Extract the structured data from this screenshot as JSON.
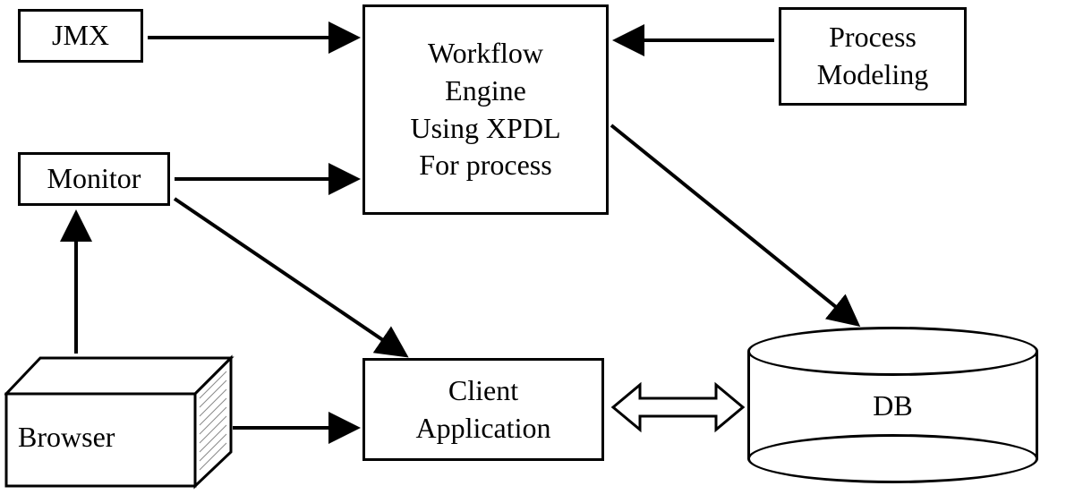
{
  "nodes": {
    "jmx": "JMX",
    "monitor": "Monitor",
    "browser": "Browser",
    "workflow_l1": "Workflow",
    "workflow_l2": "Engine",
    "workflow_l3": "Using XPDL",
    "workflow_l4": "For process",
    "process_l1": "Process",
    "process_l2": "Modeling",
    "client_l1": "Client",
    "client_l2": "Application",
    "db": "DB"
  },
  "diagram": {
    "type": "architecture",
    "edges": [
      {
        "from": "JMX",
        "to": "Workflow Engine",
        "direction": "uni"
      },
      {
        "from": "Process Modeling",
        "to": "Workflow Engine",
        "direction": "uni"
      },
      {
        "from": "Monitor",
        "to": "Workflow Engine",
        "direction": "uni"
      },
      {
        "from": "Monitor",
        "to": "Client Application",
        "direction": "uni"
      },
      {
        "from": "Browser",
        "to": "Monitor",
        "direction": "uni"
      },
      {
        "from": "Browser",
        "to": "Client Application",
        "direction": "uni"
      },
      {
        "from": "Workflow Engine",
        "to": "DB",
        "direction": "uni"
      },
      {
        "from": "Client Application",
        "to": "DB",
        "direction": "bi"
      }
    ]
  }
}
